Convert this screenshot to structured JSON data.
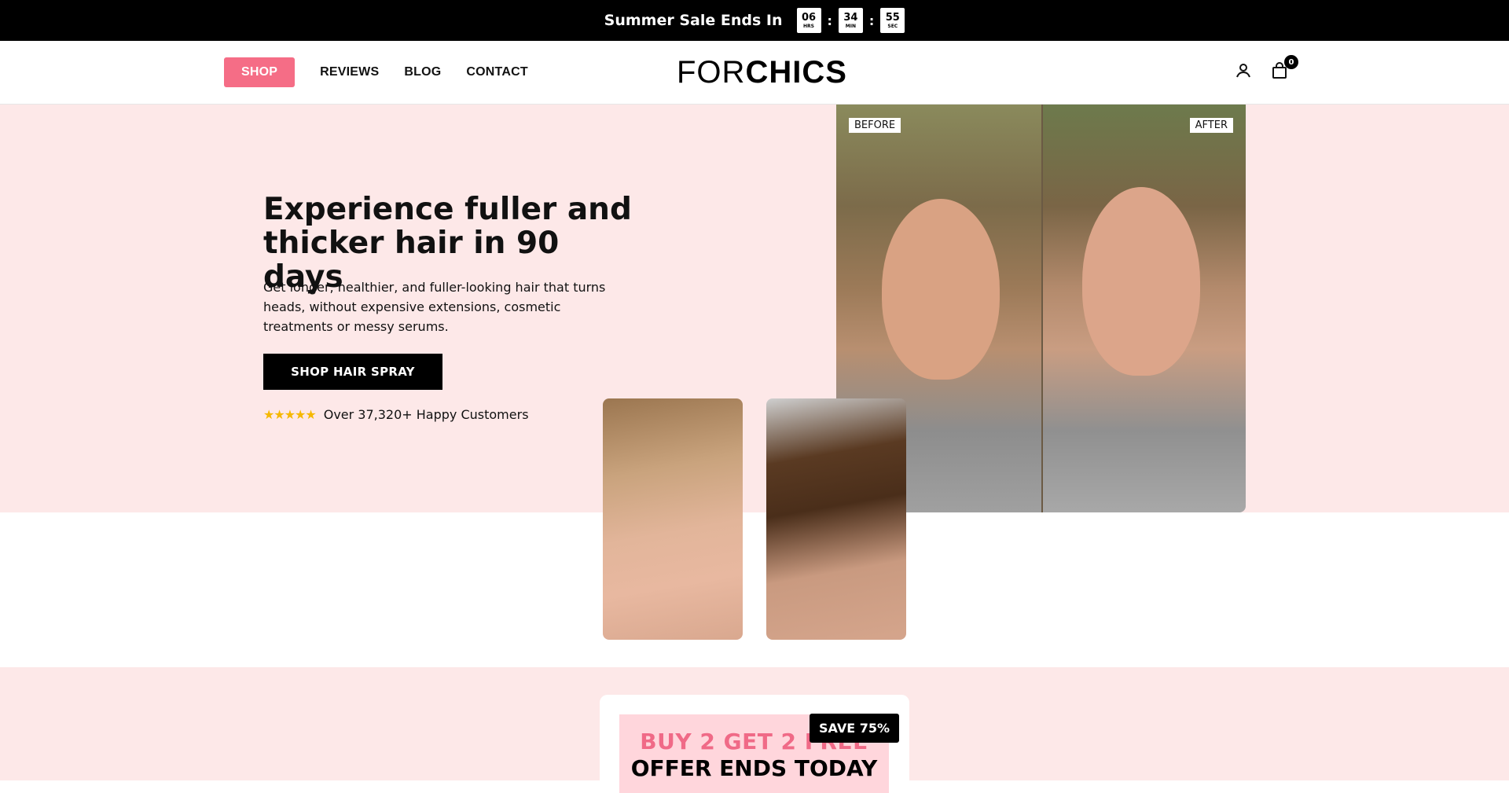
{
  "announcement": {
    "label": "Summer Sale Ends In",
    "timer": [
      {
        "value": "06",
        "unit": "HRS"
      },
      {
        "value": "34",
        "unit": "MIN"
      },
      {
        "value": "55",
        "unit": "SEC"
      }
    ],
    "separator": ":"
  },
  "nav": {
    "items": [
      {
        "label": "SHOP"
      },
      {
        "label": "REVIEWS"
      },
      {
        "label": "BLOG"
      },
      {
        "label": "CONTACT"
      }
    ]
  },
  "logo": {
    "thin": "FOR",
    "bold": "CHICS"
  },
  "header_icons": {
    "account": "user-icon",
    "cart": "bag-icon",
    "cart_count": "0"
  },
  "hero": {
    "title": "Experience fuller and thicker hair in 90 days",
    "description": "Get longer, healthier, and fuller-looking hair that turns heads, without expensive extensions, cosmetic treatments or messy serums.",
    "button": "SHOP HAIR SPRAY",
    "stars": "★★★★★",
    "rating_text": "Over 37,320+ Happy Customers"
  },
  "before_after": {
    "before": "BEFORE",
    "after": "AFTER"
  },
  "offer": {
    "line1": "BUY 2 GET 2 FREE",
    "line2": "OFFER ENDS TODAY",
    "badge": "SAVE 75%"
  },
  "colors": {
    "accent": "#f56d86",
    "hero_bg": "#fde8e8",
    "black": "#000000"
  }
}
